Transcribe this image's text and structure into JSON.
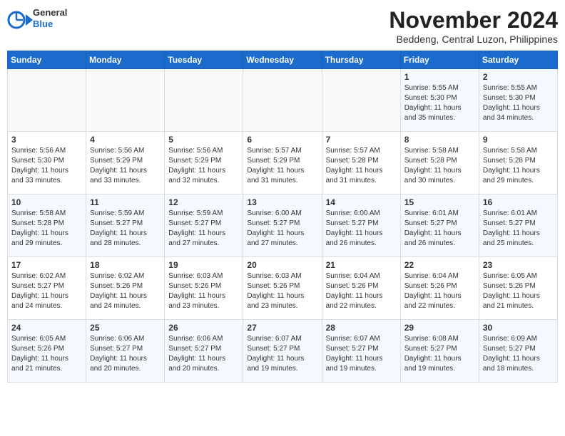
{
  "header": {
    "logo_line1": "General",
    "logo_line2": "Blue",
    "month": "November 2024",
    "location": "Beddeng, Central Luzon, Philippines"
  },
  "weekdays": [
    "Sunday",
    "Monday",
    "Tuesday",
    "Wednesday",
    "Thursday",
    "Friday",
    "Saturday"
  ],
  "weeks": [
    [
      {
        "day": "",
        "info": ""
      },
      {
        "day": "",
        "info": ""
      },
      {
        "day": "",
        "info": ""
      },
      {
        "day": "",
        "info": ""
      },
      {
        "day": "",
        "info": ""
      },
      {
        "day": "1",
        "info": "Sunrise: 5:55 AM\nSunset: 5:30 PM\nDaylight: 11 hours\nand 35 minutes."
      },
      {
        "day": "2",
        "info": "Sunrise: 5:55 AM\nSunset: 5:30 PM\nDaylight: 11 hours\nand 34 minutes."
      }
    ],
    [
      {
        "day": "3",
        "info": "Sunrise: 5:56 AM\nSunset: 5:30 PM\nDaylight: 11 hours\nand 33 minutes."
      },
      {
        "day": "4",
        "info": "Sunrise: 5:56 AM\nSunset: 5:29 PM\nDaylight: 11 hours\nand 33 minutes."
      },
      {
        "day": "5",
        "info": "Sunrise: 5:56 AM\nSunset: 5:29 PM\nDaylight: 11 hours\nand 32 minutes."
      },
      {
        "day": "6",
        "info": "Sunrise: 5:57 AM\nSunset: 5:29 PM\nDaylight: 11 hours\nand 31 minutes."
      },
      {
        "day": "7",
        "info": "Sunrise: 5:57 AM\nSunset: 5:28 PM\nDaylight: 11 hours\nand 31 minutes."
      },
      {
        "day": "8",
        "info": "Sunrise: 5:58 AM\nSunset: 5:28 PM\nDaylight: 11 hours\nand 30 minutes."
      },
      {
        "day": "9",
        "info": "Sunrise: 5:58 AM\nSunset: 5:28 PM\nDaylight: 11 hours\nand 29 minutes."
      }
    ],
    [
      {
        "day": "10",
        "info": "Sunrise: 5:58 AM\nSunset: 5:28 PM\nDaylight: 11 hours\nand 29 minutes."
      },
      {
        "day": "11",
        "info": "Sunrise: 5:59 AM\nSunset: 5:27 PM\nDaylight: 11 hours\nand 28 minutes."
      },
      {
        "day": "12",
        "info": "Sunrise: 5:59 AM\nSunset: 5:27 PM\nDaylight: 11 hours\nand 27 minutes."
      },
      {
        "day": "13",
        "info": "Sunrise: 6:00 AM\nSunset: 5:27 PM\nDaylight: 11 hours\nand 27 minutes."
      },
      {
        "day": "14",
        "info": "Sunrise: 6:00 AM\nSunset: 5:27 PM\nDaylight: 11 hours\nand 26 minutes."
      },
      {
        "day": "15",
        "info": "Sunrise: 6:01 AM\nSunset: 5:27 PM\nDaylight: 11 hours\nand 26 minutes."
      },
      {
        "day": "16",
        "info": "Sunrise: 6:01 AM\nSunset: 5:27 PM\nDaylight: 11 hours\nand 25 minutes."
      }
    ],
    [
      {
        "day": "17",
        "info": "Sunrise: 6:02 AM\nSunset: 5:27 PM\nDaylight: 11 hours\nand 24 minutes."
      },
      {
        "day": "18",
        "info": "Sunrise: 6:02 AM\nSunset: 5:26 PM\nDaylight: 11 hours\nand 24 minutes."
      },
      {
        "day": "19",
        "info": "Sunrise: 6:03 AM\nSunset: 5:26 PM\nDaylight: 11 hours\nand 23 minutes."
      },
      {
        "day": "20",
        "info": "Sunrise: 6:03 AM\nSunset: 5:26 PM\nDaylight: 11 hours\nand 23 minutes."
      },
      {
        "day": "21",
        "info": "Sunrise: 6:04 AM\nSunset: 5:26 PM\nDaylight: 11 hours\nand 22 minutes."
      },
      {
        "day": "22",
        "info": "Sunrise: 6:04 AM\nSunset: 5:26 PM\nDaylight: 11 hours\nand 22 minutes."
      },
      {
        "day": "23",
        "info": "Sunrise: 6:05 AM\nSunset: 5:26 PM\nDaylight: 11 hours\nand 21 minutes."
      }
    ],
    [
      {
        "day": "24",
        "info": "Sunrise: 6:05 AM\nSunset: 5:26 PM\nDaylight: 11 hours\nand 21 minutes."
      },
      {
        "day": "25",
        "info": "Sunrise: 6:06 AM\nSunset: 5:27 PM\nDaylight: 11 hours\nand 20 minutes."
      },
      {
        "day": "26",
        "info": "Sunrise: 6:06 AM\nSunset: 5:27 PM\nDaylight: 11 hours\nand 20 minutes."
      },
      {
        "day": "27",
        "info": "Sunrise: 6:07 AM\nSunset: 5:27 PM\nDaylight: 11 hours\nand 19 minutes."
      },
      {
        "day": "28",
        "info": "Sunrise: 6:07 AM\nSunset: 5:27 PM\nDaylight: 11 hours\nand 19 minutes."
      },
      {
        "day": "29",
        "info": "Sunrise: 6:08 AM\nSunset: 5:27 PM\nDaylight: 11 hours\nand 19 minutes."
      },
      {
        "day": "30",
        "info": "Sunrise: 6:09 AM\nSunset: 5:27 PM\nDaylight: 11 hours\nand 18 minutes."
      }
    ]
  ]
}
